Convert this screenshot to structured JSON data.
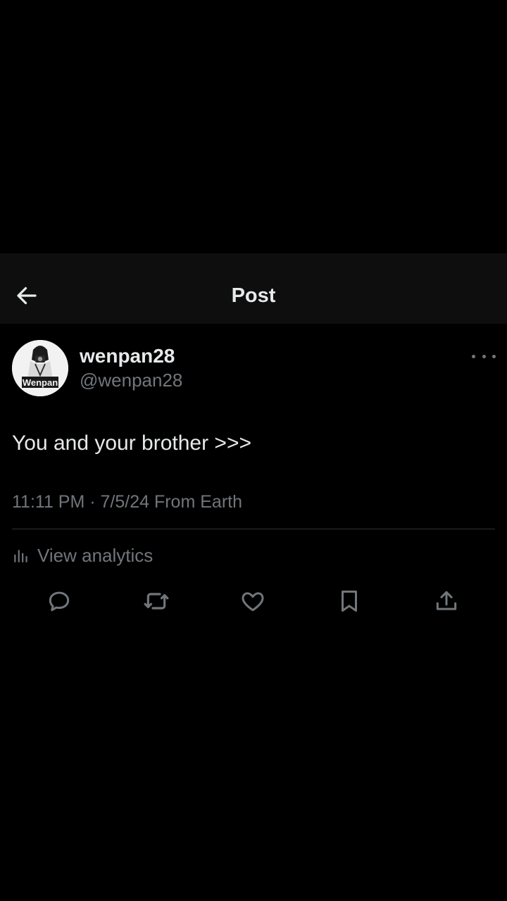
{
  "header": {
    "title": "Post",
    "back_icon": "arrow-left-icon"
  },
  "post": {
    "avatar_text": "Wenpan",
    "display_name": "wenpan28",
    "handle": "@wenpan28",
    "text": "You and your brother >>>",
    "meta": "11:11 PM · 7/5/24 From Earth",
    "analytics_label": "View analytics"
  },
  "actions": [
    {
      "name": "reply",
      "icon": "reply-icon"
    },
    {
      "name": "repost",
      "icon": "repost-icon"
    },
    {
      "name": "like",
      "icon": "heart-icon"
    },
    {
      "name": "bookmark",
      "icon": "bookmark-icon"
    },
    {
      "name": "share",
      "icon": "share-icon"
    }
  ],
  "colors": {
    "background": "#000000",
    "header_background": "#0e0e0e",
    "primary_text": "#e7e9ea",
    "secondary_text": "#71767b",
    "divider": "#2f3336"
  }
}
